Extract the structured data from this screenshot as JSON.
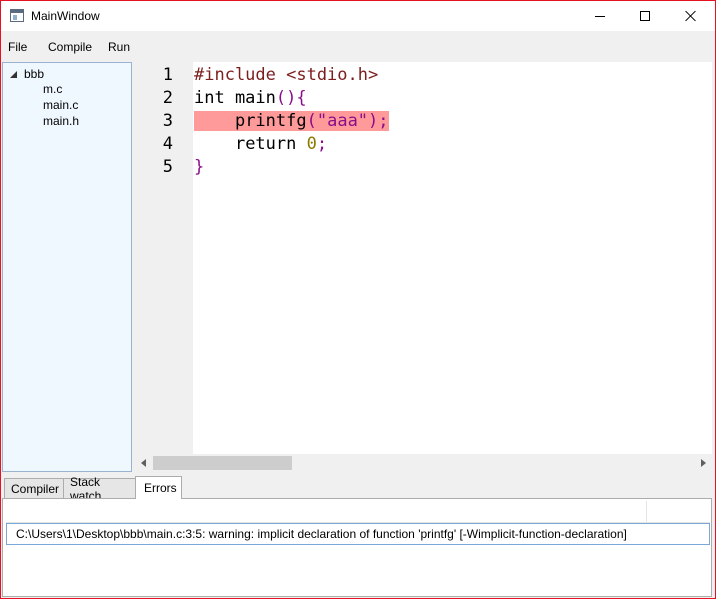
{
  "window": {
    "title": "MainWindow"
  },
  "menu": {
    "items": [
      "File",
      "Compile",
      "Run"
    ]
  },
  "tree": {
    "root": "bbb",
    "children": [
      "m.c",
      "main.c",
      "main.h"
    ]
  },
  "editor": {
    "line_numbers": [
      "1",
      "2",
      "3",
      "4",
      "5"
    ],
    "highlighted_line": 3,
    "highlight_color": "#ff9a9a",
    "colors": {
      "preprocessor": "#7b1e1e",
      "keyword": "#000000",
      "punct": "#8a0d8a",
      "string": "#8a0d8a",
      "number": "#8a7a00"
    }
  },
  "bottom_tabs": {
    "items": [
      "Compiler",
      "Stack watch",
      "Errors"
    ],
    "active": "Errors"
  },
  "errors": {
    "rows": [
      "C:\\Users\\1\\Desktop\\bbb\\main.c:3:5: warning: implicit declaration of function 'printfg' [-Wimplicit-function-declaration]"
    ]
  }
}
